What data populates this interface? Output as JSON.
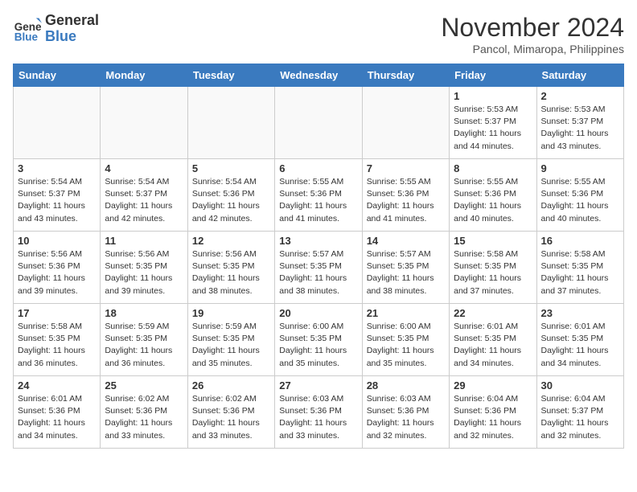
{
  "header": {
    "logo_line1": "General",
    "logo_line2": "Blue",
    "month": "November 2024",
    "location": "Pancol, Mimaropa, Philippines"
  },
  "weekdays": [
    "Sunday",
    "Monday",
    "Tuesday",
    "Wednesday",
    "Thursday",
    "Friday",
    "Saturday"
  ],
  "weeks": [
    [
      {
        "day": "",
        "info": ""
      },
      {
        "day": "",
        "info": ""
      },
      {
        "day": "",
        "info": ""
      },
      {
        "day": "",
        "info": ""
      },
      {
        "day": "",
        "info": ""
      },
      {
        "day": "1",
        "info": "Sunrise: 5:53 AM\nSunset: 5:37 PM\nDaylight: 11 hours\nand 44 minutes."
      },
      {
        "day": "2",
        "info": "Sunrise: 5:53 AM\nSunset: 5:37 PM\nDaylight: 11 hours\nand 43 minutes."
      }
    ],
    [
      {
        "day": "3",
        "info": "Sunrise: 5:54 AM\nSunset: 5:37 PM\nDaylight: 11 hours\nand 43 minutes."
      },
      {
        "day": "4",
        "info": "Sunrise: 5:54 AM\nSunset: 5:37 PM\nDaylight: 11 hours\nand 42 minutes."
      },
      {
        "day": "5",
        "info": "Sunrise: 5:54 AM\nSunset: 5:36 PM\nDaylight: 11 hours\nand 42 minutes."
      },
      {
        "day": "6",
        "info": "Sunrise: 5:55 AM\nSunset: 5:36 PM\nDaylight: 11 hours\nand 41 minutes."
      },
      {
        "day": "7",
        "info": "Sunrise: 5:55 AM\nSunset: 5:36 PM\nDaylight: 11 hours\nand 41 minutes."
      },
      {
        "day": "8",
        "info": "Sunrise: 5:55 AM\nSunset: 5:36 PM\nDaylight: 11 hours\nand 40 minutes."
      },
      {
        "day": "9",
        "info": "Sunrise: 5:55 AM\nSunset: 5:36 PM\nDaylight: 11 hours\nand 40 minutes."
      }
    ],
    [
      {
        "day": "10",
        "info": "Sunrise: 5:56 AM\nSunset: 5:36 PM\nDaylight: 11 hours\nand 39 minutes."
      },
      {
        "day": "11",
        "info": "Sunrise: 5:56 AM\nSunset: 5:35 PM\nDaylight: 11 hours\nand 39 minutes."
      },
      {
        "day": "12",
        "info": "Sunrise: 5:56 AM\nSunset: 5:35 PM\nDaylight: 11 hours\nand 38 minutes."
      },
      {
        "day": "13",
        "info": "Sunrise: 5:57 AM\nSunset: 5:35 PM\nDaylight: 11 hours\nand 38 minutes."
      },
      {
        "day": "14",
        "info": "Sunrise: 5:57 AM\nSunset: 5:35 PM\nDaylight: 11 hours\nand 38 minutes."
      },
      {
        "day": "15",
        "info": "Sunrise: 5:58 AM\nSunset: 5:35 PM\nDaylight: 11 hours\nand 37 minutes."
      },
      {
        "day": "16",
        "info": "Sunrise: 5:58 AM\nSunset: 5:35 PM\nDaylight: 11 hours\nand 37 minutes."
      }
    ],
    [
      {
        "day": "17",
        "info": "Sunrise: 5:58 AM\nSunset: 5:35 PM\nDaylight: 11 hours\nand 36 minutes."
      },
      {
        "day": "18",
        "info": "Sunrise: 5:59 AM\nSunset: 5:35 PM\nDaylight: 11 hours\nand 36 minutes."
      },
      {
        "day": "19",
        "info": "Sunrise: 5:59 AM\nSunset: 5:35 PM\nDaylight: 11 hours\nand 35 minutes."
      },
      {
        "day": "20",
        "info": "Sunrise: 6:00 AM\nSunset: 5:35 PM\nDaylight: 11 hours\nand 35 minutes."
      },
      {
        "day": "21",
        "info": "Sunrise: 6:00 AM\nSunset: 5:35 PM\nDaylight: 11 hours\nand 35 minutes."
      },
      {
        "day": "22",
        "info": "Sunrise: 6:01 AM\nSunset: 5:35 PM\nDaylight: 11 hours\nand 34 minutes."
      },
      {
        "day": "23",
        "info": "Sunrise: 6:01 AM\nSunset: 5:35 PM\nDaylight: 11 hours\nand 34 minutes."
      }
    ],
    [
      {
        "day": "24",
        "info": "Sunrise: 6:01 AM\nSunset: 5:36 PM\nDaylight: 11 hours\nand 34 minutes."
      },
      {
        "day": "25",
        "info": "Sunrise: 6:02 AM\nSunset: 5:36 PM\nDaylight: 11 hours\nand 33 minutes."
      },
      {
        "day": "26",
        "info": "Sunrise: 6:02 AM\nSunset: 5:36 PM\nDaylight: 11 hours\nand 33 minutes."
      },
      {
        "day": "27",
        "info": "Sunrise: 6:03 AM\nSunset: 5:36 PM\nDaylight: 11 hours\nand 33 minutes."
      },
      {
        "day": "28",
        "info": "Sunrise: 6:03 AM\nSunset: 5:36 PM\nDaylight: 11 hours\nand 32 minutes."
      },
      {
        "day": "29",
        "info": "Sunrise: 6:04 AM\nSunset: 5:36 PM\nDaylight: 11 hours\nand 32 minutes."
      },
      {
        "day": "30",
        "info": "Sunrise: 6:04 AM\nSunset: 5:37 PM\nDaylight: 11 hours\nand 32 minutes."
      }
    ]
  ]
}
